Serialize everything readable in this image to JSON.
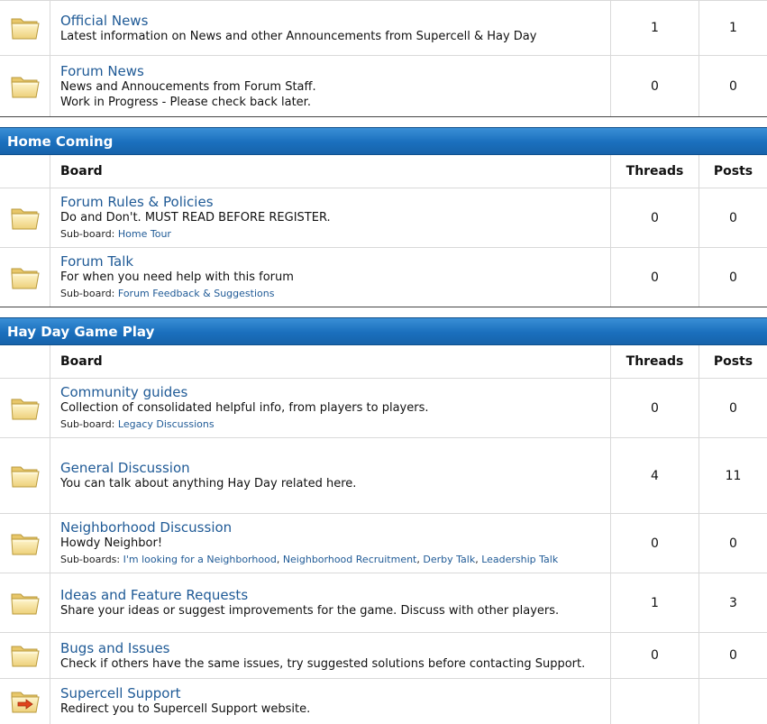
{
  "section0": {
    "boards": [
      {
        "title": "Official News",
        "desc": [
          "Latest information on News and other Announcements from Supercell & Hay Day"
        ],
        "threads": "1",
        "posts": "1"
      },
      {
        "title": "Forum News",
        "desc": [
          "News and Annoucements from Forum Staff.",
          "Work in Progress - Please check back later."
        ],
        "threads": "0",
        "posts": "0"
      }
    ]
  },
  "section1": {
    "title": "Home Coming",
    "col_board": "Board",
    "col_threads": "Threads",
    "col_posts": "Posts",
    "boards": [
      {
        "title": "Forum Rules & Policies",
        "desc": "Do and Don't. MUST READ BEFORE REGISTER.",
        "sub_label": "Sub-board:",
        "subs": [
          "Home Tour"
        ],
        "threads": "0",
        "posts": "0"
      },
      {
        "title": "Forum Talk",
        "desc": "For when you need help with this forum",
        "sub_label": "Sub-board:",
        "subs": [
          "Forum Feedback & Suggestions"
        ],
        "threads": "0",
        "posts": "0"
      }
    ]
  },
  "section2": {
    "title": "Hay Day Game Play",
    "col_board": "Board",
    "col_threads": "Threads",
    "col_posts": "Posts",
    "boards": [
      {
        "title": "Community guides",
        "desc": "Collection of consolidated helpful info, from players to players.",
        "sub_label": "Sub-board:",
        "subs": [
          "Legacy Discussions"
        ],
        "threads": "0",
        "posts": "0"
      },
      {
        "title": "General Discussion",
        "desc": "You can talk about anything Hay Day related here.",
        "threads": "4",
        "posts": "11"
      },
      {
        "title": "Neighborhood Discussion",
        "desc": "Howdy Neighbor!",
        "sub_label": "Sub-boards:",
        "subs": [
          "I'm looking for a Neighborhood",
          "Neighborhood Recruitment",
          "Derby Talk",
          "Leadership Talk"
        ],
        "threads": "0",
        "posts": "0"
      },
      {
        "title": "Ideas and Feature Requests",
        "desc": "Share your ideas or suggest improvements for the game. Discuss with other players.",
        "threads": "1",
        "posts": "3"
      },
      {
        "title": "Bugs and Issues",
        "desc": "Check if others have the same issues, try suggested solutions before contacting Support.",
        "threads": "0",
        "posts": "0"
      },
      {
        "title": "Supercell Support",
        "desc": "Redirect you to Supercell Support website.",
        "threads": "",
        "posts": ""
      }
    ]
  },
  "colors": {
    "link": "#1f5a96",
    "header_blue": "#1a6fbd",
    "folder": "#f3dc8e"
  },
  "icons": {
    "folder": "folder-icon",
    "redirect": "redirect-folder-icon"
  }
}
